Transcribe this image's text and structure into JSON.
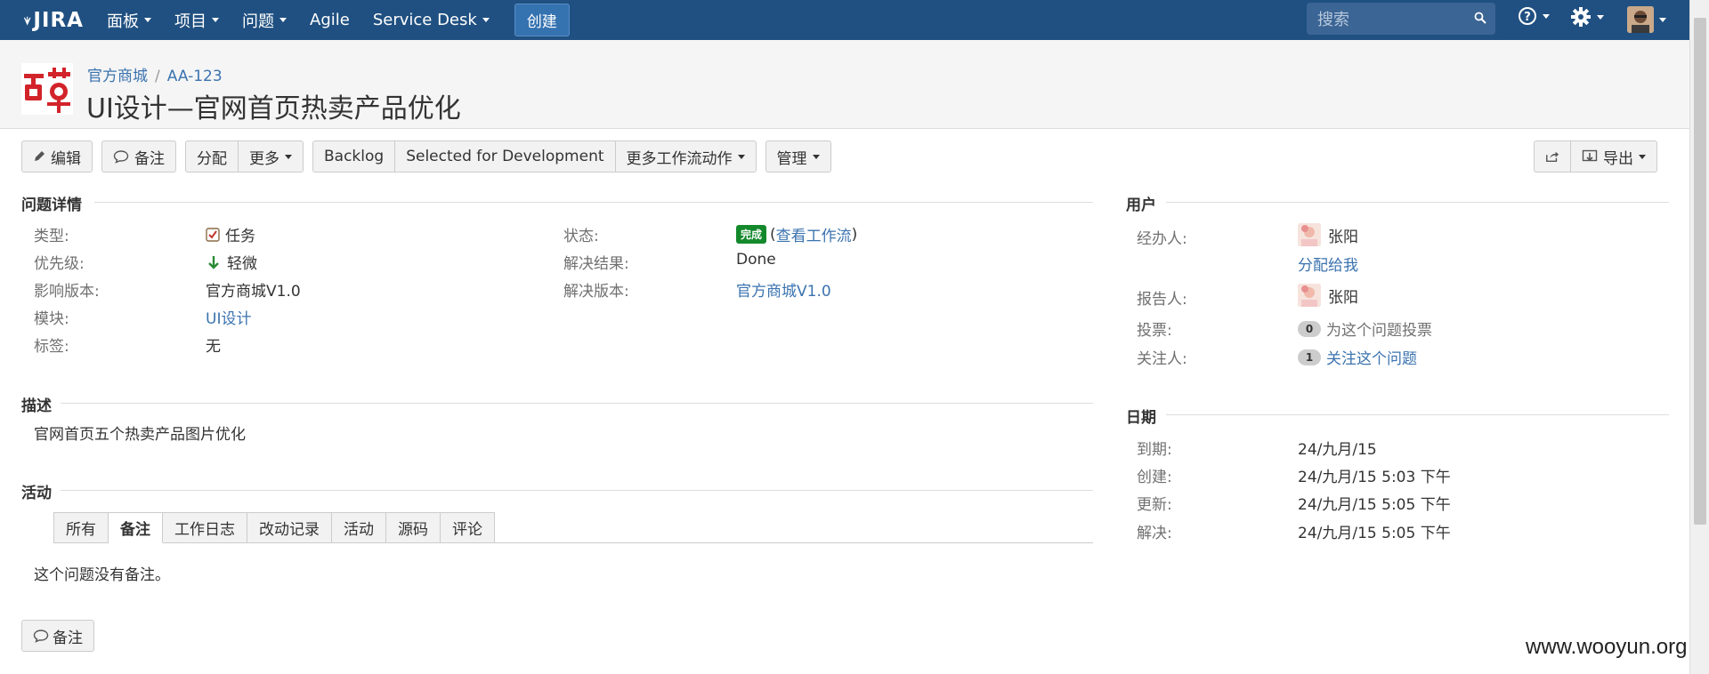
{
  "nav": {
    "logo": "JIRA",
    "items": [
      "面板",
      "项目",
      "问题",
      "Agile",
      "Service Desk"
    ],
    "create": "创建",
    "search_placeholder": "搜索"
  },
  "header": {
    "project": "官方商城",
    "issue_key": "AA-123",
    "summary": "UI设计—官网首页热卖产品优化"
  },
  "toolbar": {
    "edit": "编辑",
    "comment": "备注",
    "assign": "分配",
    "more": "更多",
    "backlog": "Backlog",
    "selected_for_dev": "Selected for Development",
    "more_workflow": "更多工作流动作",
    "admin": "管理",
    "export": "导出"
  },
  "details": {
    "title": "问题详情",
    "type_label": "类型:",
    "type_value": "任务",
    "priority_label": "优先级:",
    "priority_value": "轻微",
    "affects_label": "影响版本:",
    "affects_value": "官方商城V1.0",
    "component_label": "模块:",
    "component_value": "UI设计",
    "labels_label": "标签:",
    "labels_value": "无",
    "status_label": "状态:",
    "status_value": "完成",
    "view_workflow": "查看工作流",
    "resolution_label": "解决结果:",
    "resolution_value": "Done",
    "fix_label": "解决版本:",
    "fix_value": "官方商城V1.0"
  },
  "description": {
    "title": "描述",
    "text": "官网首页五个热卖产品图片优化"
  },
  "activity": {
    "title": "活动",
    "tabs": [
      "所有",
      "备注",
      "工作日志",
      "改动记录",
      "活动",
      "源码",
      "评论"
    ],
    "active_tab": "备注",
    "empty": "这个问题没有备注。",
    "comment_button": "备注"
  },
  "people": {
    "title": "用户",
    "assignee_label": "经办人:",
    "assignee": "张阳",
    "assign_to_me": "分配给我",
    "reporter_label": "报告人:",
    "reporter": "张阳",
    "votes_label": "投票:",
    "votes_count": "0",
    "vote_link": "为这个问题投票",
    "watchers_label": "关注人:",
    "watchers_count": "1",
    "watch_link": "关注这个问题"
  },
  "dates": {
    "title": "日期",
    "due_label": "到期:",
    "due": "24/九月/15",
    "created_label": "创建:",
    "created": "24/九月/15 5:03 下午",
    "updated_label": "更新:",
    "updated": "24/九月/15 5:05 下午",
    "resolved_label": "解决:",
    "resolved": "24/九月/15 5:05 下午"
  },
  "watermark": "www.wooyun.org",
  "colors": {
    "nav_bg": "#205081",
    "link": "#3b73af",
    "done_green": "#14892c"
  }
}
